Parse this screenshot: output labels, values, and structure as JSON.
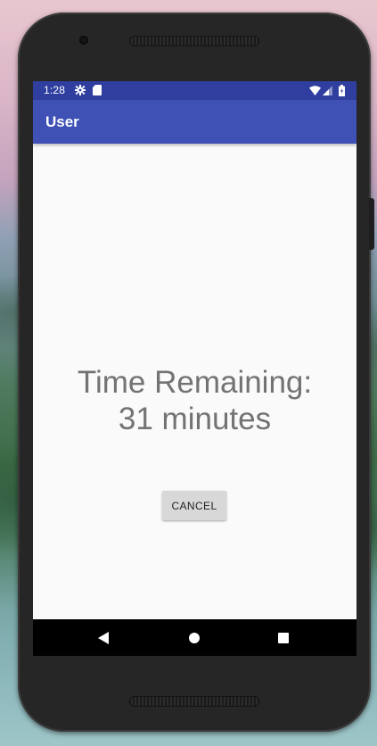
{
  "status_bar": {
    "time": "1:28",
    "icons": [
      "settings-icon",
      "sd-card-icon",
      "wifi-icon",
      "signal-icon",
      "battery-icon"
    ],
    "color": "#303f9f"
  },
  "app_bar": {
    "title": "User",
    "color": "#3f51b5"
  },
  "main": {
    "time_remaining_line1": "Time Remaining:",
    "time_remaining_line2": "31 minutes",
    "cancel_label": "CANCEL"
  },
  "nav_bar": {
    "icons": [
      "back-icon",
      "home-icon",
      "recents-icon"
    ]
  }
}
